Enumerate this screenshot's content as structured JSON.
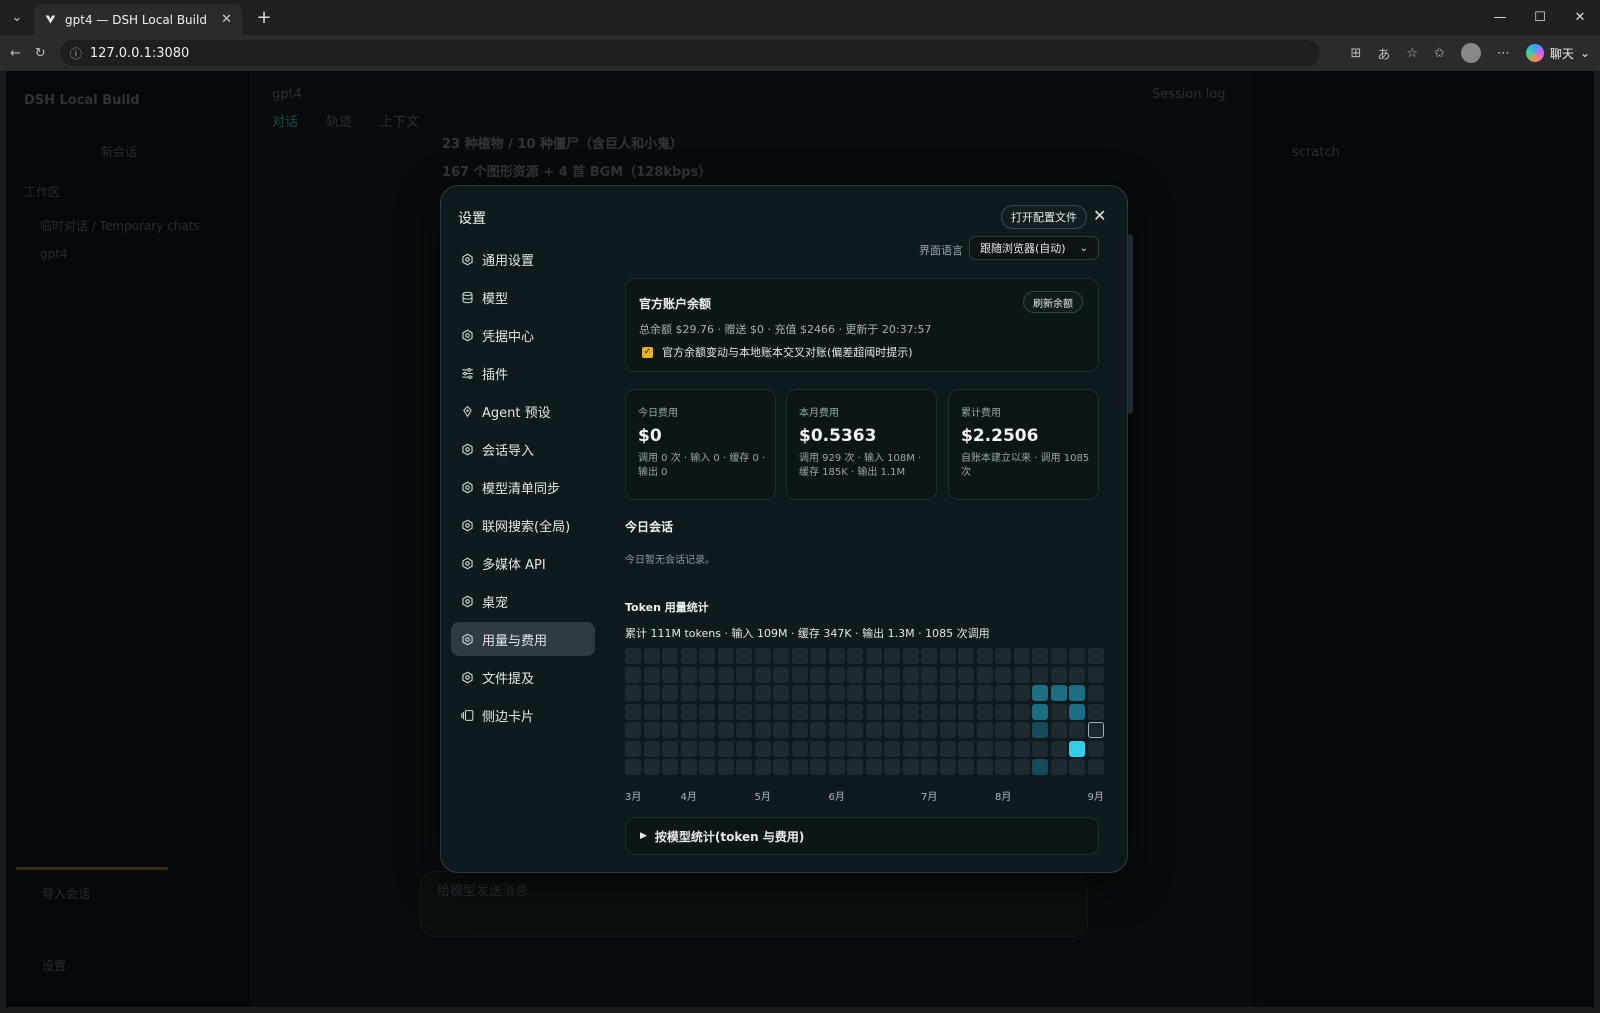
{
  "browser": {
    "tab_title": "gpt4 — DSH Local Build",
    "url": "127.0.0.1:3080",
    "copilot_label": "聊天"
  },
  "background": {
    "app_name": "DSH Local Build",
    "new_chat": "新会话",
    "workspace": "工作区",
    "folder": "临时对话 / Temporary chats",
    "chat_item": "gpt4",
    "breadcrumb": "gpt4",
    "tab_overview": "对话",
    "tab_files": "轨迹",
    "tab_more": "上下文",
    "bullet1": "23 种植物 / 10 种僵尸（含巨人和小鬼）",
    "bullet2": "167 个图形资源 + 4 首 BGM（128kbps）",
    "right_title": "Session log",
    "right_item": "scratch",
    "input_placeholder": "给模型发送消息",
    "bottom_left": "设置",
    "import": "导入会话"
  },
  "settings": {
    "title": "设置",
    "open_config": "打开配置文件",
    "language_label": "界面语言",
    "language_value": "跟随浏览器(自动)",
    "nav": [
      {
        "label": "通用设置",
        "icon": "gear-icon"
      },
      {
        "label": "模型",
        "icon": "database-icon"
      },
      {
        "label": "凭据中心",
        "icon": "gear-icon"
      },
      {
        "label": "插件",
        "icon": "sliders-icon"
      },
      {
        "label": "Agent 预设",
        "icon": "agent-icon"
      },
      {
        "label": "会话导入",
        "icon": "gear-icon"
      },
      {
        "label": "模型清单同步",
        "icon": "gear-icon"
      },
      {
        "label": "联网搜索(全局)",
        "icon": "gear-icon"
      },
      {
        "label": "多媒体 API",
        "icon": "gear-icon"
      },
      {
        "label": "桌宠",
        "icon": "gear-icon"
      },
      {
        "label": "用量与费用",
        "icon": "gear-icon",
        "active": true
      },
      {
        "label": "文件提及",
        "icon": "gear-icon"
      },
      {
        "label": "侧边卡片",
        "icon": "cards-icon"
      }
    ],
    "balance": {
      "title": "官方账户余额",
      "refresh": "刷新余额",
      "line": "总余额 $29.76 · 赠送 $0 · 充值 $2466 · 更新于 20:37:57",
      "check_label": "官方余额变动与本地账本交叉对账(偏差超阈时提示)",
      "checked": true
    },
    "stats": [
      {
        "label": "今日费用",
        "value": "$0",
        "sub": "调用 0 次 · 输入 0 · 缓存 0 · 输出 0"
      },
      {
        "label": "本月费用",
        "value": "$0.5363",
        "sub": "调用 929 次 · 输入 108M · 缓存 185K · 输出 1.1M"
      },
      {
        "label": "累计费用",
        "value": "$2.2506",
        "sub": "自账本建立以来 · 调用 1085 次"
      }
    ],
    "today_sessions_title": "今日会话",
    "today_sessions_empty": "今日暂无会话记录。",
    "token_title": "Token 用量统计",
    "token_summary": "累计 111M tokens · 输入 109M · 缓存 347K · 输出 1.3M · 1085 次调用",
    "heatmap": {
      "weeks": 26,
      "days": 7,
      "months": [
        "3月",
        "4月",
        "5月",
        "6月",
        "7月",
        "8月",
        "9月"
      ],
      "active_cells": [
        {
          "w": 22,
          "d": 2,
          "level": 2
        },
        {
          "w": 23,
          "d": 2,
          "level": 2
        },
        {
          "w": 24,
          "d": 2,
          "level": 2
        },
        {
          "w": 22,
          "d": 3,
          "level": 2
        },
        {
          "w": 24,
          "d": 3,
          "level": 2
        },
        {
          "w": 22,
          "d": 4,
          "level": 1
        },
        {
          "w": 25,
          "d": 4,
          "level": "sel"
        },
        {
          "w": 24,
          "d": 5,
          "level": 4
        },
        {
          "w": 22,
          "d": 6,
          "level": 1
        }
      ]
    },
    "by_model": "按模型统计(token 与费用)",
    "colors": {
      "accent": "#33cfe8",
      "checkbox": "#e7b415",
      "active_nav": "#2e3b40"
    }
  }
}
